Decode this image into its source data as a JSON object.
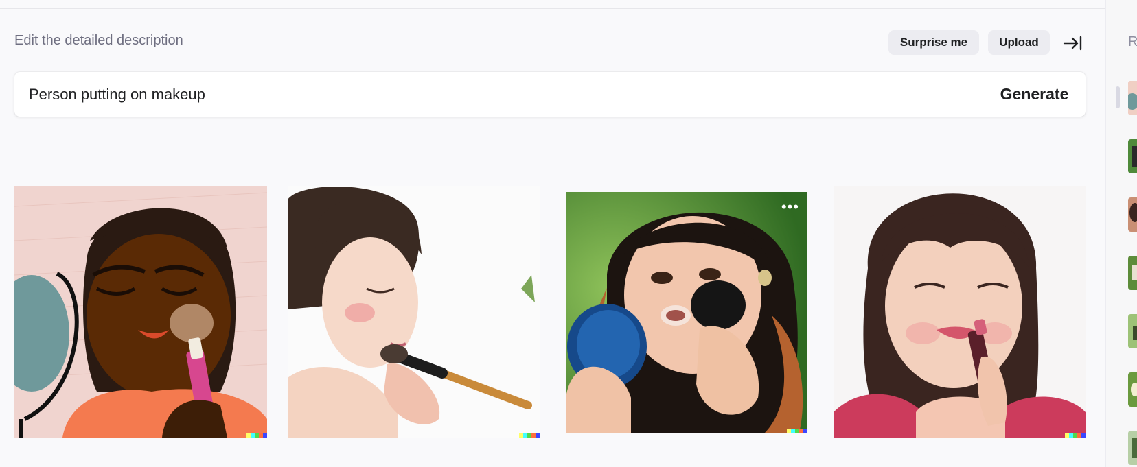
{
  "header": {
    "label": "Edit the detailed description",
    "surprise_label": "Surprise me",
    "upload_label": "Upload"
  },
  "prompt": {
    "value": "Person putting on makeup",
    "generate_label": "Generate"
  },
  "gallery": {
    "more_glyph": "•••",
    "images": [
      "illustration of a person with eyes closed applying blush",
      "photo of a woman holding a makeup brush",
      "photo of a girl applying powder with a compact mirror",
      "photo of a woman applying lipstick"
    ]
  },
  "sidebar": {
    "heading": "R"
  },
  "colors": {
    "background": "#f9f9fb",
    "button_bg": "#ececf1",
    "muted_text": "#6e6e80",
    "signature": [
      "#ffff66",
      "#42ffff",
      "#51da4c",
      "#ff6e3c",
      "#3c46ff"
    ]
  }
}
